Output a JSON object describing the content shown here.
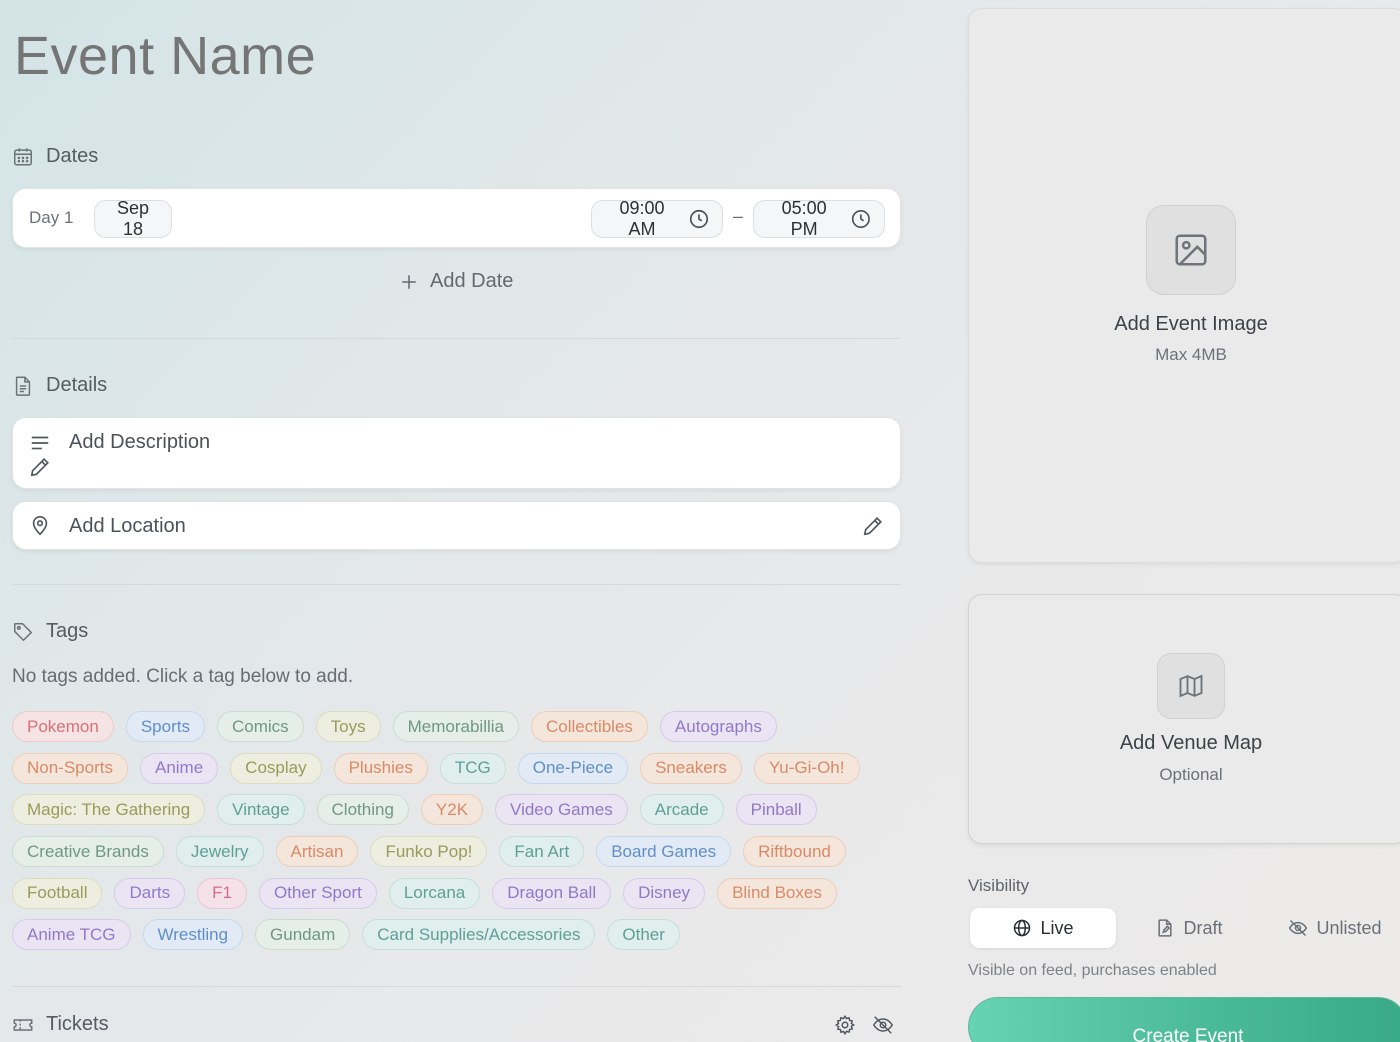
{
  "event": {
    "name_placeholder": "Event Name"
  },
  "dates": {
    "heading": "Dates",
    "days": [
      {
        "label": "Day 1",
        "date": "Sep 18",
        "start_time": "09:00 AM",
        "end_time": "05:00 PM"
      }
    ],
    "separator": "–",
    "add_label": "Add Date"
  },
  "details": {
    "heading": "Details",
    "description_label": "Add Description",
    "location_label": "Add Location"
  },
  "tags": {
    "heading": "Tags",
    "help": "No tags added. Click a tag below to add.",
    "rows": [
      [
        "Pokemon",
        "Sports",
        "Comics",
        "Toys",
        "Memorabillia",
        "Collectibles",
        "Autographs"
      ],
      [
        "Non-Sports",
        "Anime",
        "Cosplay",
        "Plushies",
        "TCG",
        "One-Piece",
        "Sneakers",
        "Yu-Gi-Oh!"
      ],
      [
        "Magic: The Gathering",
        "Vintage",
        "Clothing",
        "Y2K",
        "Video Games",
        "Arcade",
        "Pinball"
      ],
      [
        "Creative Brands",
        "Jewelry",
        "Artisan",
        "Funko Pop!",
        "Fan Art",
        "Board Games",
        "Riftbound"
      ],
      [
        "Football",
        "Darts",
        "F1",
        "Other Sport",
        "Lorcana",
        "Dragon Ball",
        "Disney",
        "Blind Boxes"
      ],
      [
        "Anime TCG",
        "Wrestling",
        "Gundam",
        "Card Supplies/Accessories",
        "Other"
      ]
    ],
    "colors": [
      [
        "red",
        "blue",
        "green",
        "olive",
        "green",
        "orange",
        "purple"
      ],
      [
        "orange",
        "purple",
        "olive",
        "orange",
        "teal",
        "blue",
        "orange",
        "orange"
      ],
      [
        "olive",
        "teal",
        "green",
        "orange",
        "purple",
        "teal",
        "purple"
      ],
      [
        "green",
        "teal",
        "orange",
        "olive",
        "teal",
        "blue",
        "orange"
      ],
      [
        "olive",
        "purple",
        "pink",
        "purple",
        "teal",
        "purple",
        "purple",
        "orange"
      ],
      [
        "purple",
        "blue",
        "green",
        "teal",
        "teal"
      ]
    ]
  },
  "tickets": {
    "heading": "Tickets"
  },
  "media": {
    "image_title": "Add Event Image",
    "image_sub": "Max 4MB",
    "map_title": "Add Venue Map",
    "map_sub": "Optional"
  },
  "visibility": {
    "label": "Visibility",
    "options": [
      "Live",
      "Draft",
      "Unlisted"
    ],
    "selected": "Live",
    "help": "Visible on feed, purchases enabled"
  },
  "actions": {
    "create_label": "Create Event"
  }
}
